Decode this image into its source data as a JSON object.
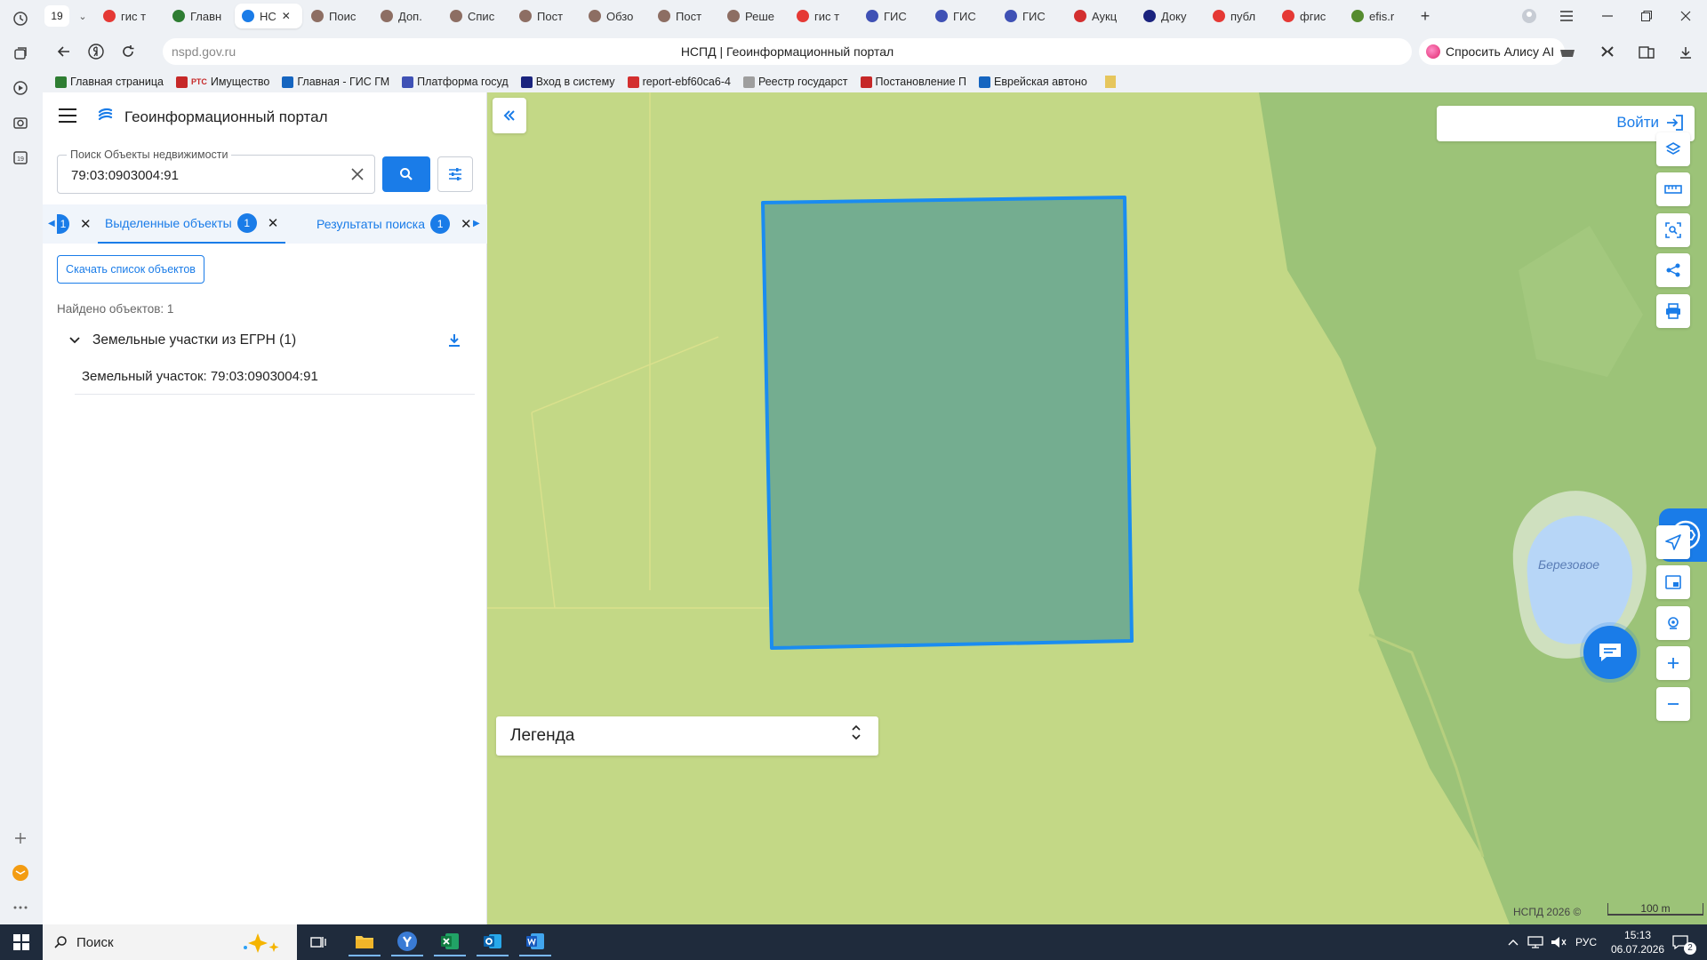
{
  "browser": {
    "tab_count": "19",
    "tabs": [
      {
        "label": "гис т",
        "color": "#e53935"
      },
      {
        "label": "Главн",
        "color": "#2e7d32"
      },
      {
        "label": "НС",
        "color": "#1a7ce8",
        "active": true
      },
      {
        "label": "Поис",
        "color": "#8d6e63"
      },
      {
        "label": "Доп.",
        "color": "#8d6e63"
      },
      {
        "label": "Спис",
        "color": "#8d6e63"
      },
      {
        "label": "Пост",
        "color": "#8d6e63"
      },
      {
        "label": "Обзо",
        "color": "#8d6e63"
      },
      {
        "label": "Пост",
        "color": "#8d6e63"
      },
      {
        "label": "Реше",
        "color": "#8d6e63"
      },
      {
        "label": "гис т",
        "color": "#e53935"
      },
      {
        "label": "ГИС",
        "color": "#3f51b5"
      },
      {
        "label": "ГИС",
        "color": "#3f51b5"
      },
      {
        "label": "ГИС",
        "color": "#3f51b5"
      },
      {
        "label": "Аукц",
        "color": "#d32f2f"
      },
      {
        "label": "Доку",
        "color": "#1a237e"
      },
      {
        "label": "публ",
        "color": "#e53935"
      },
      {
        "label": "фгис",
        "color": "#e53935"
      },
      {
        "label": "efis.r",
        "color": "#558b2f"
      }
    ],
    "url_domain": "nspd.gov.ru",
    "page_title": "НСПД | Геоинформационный портал",
    "alice_label": "Спросить Алису AI",
    "bookmarks": [
      {
        "label": "Главная страница",
        "color": "#2e7d32"
      },
      {
        "label": "Имущество",
        "color": "#c62828",
        "prefix": "РТС"
      },
      {
        "label": "Главная - ГИС ГМ",
        "color": "#1565c0"
      },
      {
        "label": "Платформа госуд",
        "color": "#3f51b5"
      },
      {
        "label": "Вход в систему",
        "color": "#1a237e"
      },
      {
        "label": "report-ebf60ca6-4",
        "color": "#d32f2f"
      },
      {
        "label": "Реестр государст",
        "color": "#9e9e9e"
      },
      {
        "label": "Постановление П",
        "color": "#c62828"
      },
      {
        "label": "Еврейская автоно",
        "color": "#1565c0"
      }
    ]
  },
  "panel": {
    "portal_title": "Геоинформационный портал",
    "search": {
      "legend": "Поиск Объекты недвижимости",
      "value": "79:03:0903004:91"
    },
    "tabs": {
      "hidden_badge": "1",
      "selected_label": "Выделенные объекты",
      "selected_count": "1",
      "results_label": "Результаты поиска",
      "results_count": "1"
    },
    "download_label": "Скачать список объектов",
    "found_text": "Найдено объектов: 1",
    "group_title": "Земельные участки из ЕГРН (1)",
    "result_item": "Земельный участок: 79:03:0903004:91"
  },
  "map": {
    "login_label": "Войти",
    "legend_label": "Легенда",
    "lake_label": "Березовое",
    "copyright": "НСПД 2026 ©",
    "scale_label": "100 m",
    "colors": {
      "field": "#c3d886",
      "forest": "#9cc378",
      "parcel_fill": "#74ad90",
      "parcel_stroke": "#1a8cf0",
      "lake": "#b7d6f7"
    }
  },
  "taskbar": {
    "search_label": "Поиск",
    "lang": "РУС",
    "time": "15:13",
    "date": "06.07.2026",
    "notif_count": "2"
  }
}
